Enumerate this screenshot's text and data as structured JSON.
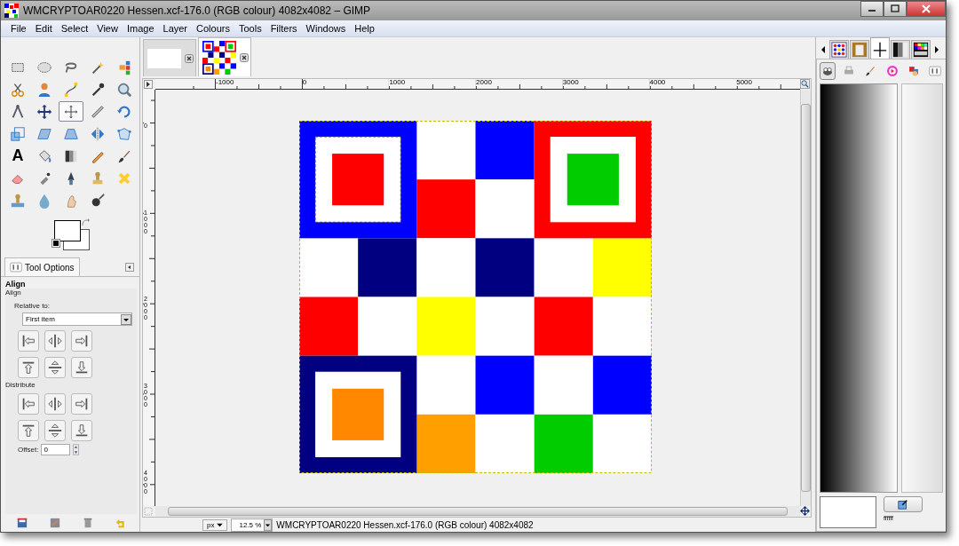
{
  "window": {
    "title": "WMCRYPTOAR0220 Hessen.xcf-176.0 (RGB colour) 4082x4082 – GIMP"
  },
  "menu": [
    "File",
    "Edit",
    "Select",
    "View",
    "Image",
    "Layer",
    "Colours",
    "Tools",
    "Filters",
    "Windows",
    "Help"
  ],
  "toolbox": {
    "tools": [
      {
        "kind": "rect-select",
        "selected": false
      },
      {
        "kind": "ellipse-select",
        "selected": false
      },
      {
        "kind": "lasso",
        "selected": false
      },
      {
        "kind": "fuzzy-select",
        "selected": false
      },
      {
        "kind": "color-select",
        "selected": false
      },
      {
        "kind": "scissors",
        "selected": false
      },
      {
        "kind": "foreground-select",
        "selected": false
      },
      {
        "kind": "paths",
        "selected": false
      },
      {
        "kind": "color-picker",
        "selected": false
      },
      {
        "kind": "zoom",
        "selected": false
      },
      {
        "kind": "measure",
        "selected": false
      },
      {
        "kind": "move",
        "selected": false
      },
      {
        "kind": "align",
        "selected": true
      },
      {
        "kind": "crop",
        "selected": false
      },
      {
        "kind": "rotate",
        "selected": false
      },
      {
        "kind": "scale",
        "selected": false
      },
      {
        "kind": "shear",
        "selected": false
      },
      {
        "kind": "perspective",
        "selected": false
      },
      {
        "kind": "flip",
        "selected": false
      },
      {
        "kind": "cage",
        "selected": false
      },
      {
        "kind": "text",
        "glyph": "A",
        "selected": false
      },
      {
        "kind": "bucket-fill",
        "selected": false
      },
      {
        "kind": "gradient",
        "selected": false
      },
      {
        "kind": "pencil",
        "selected": false
      },
      {
        "kind": "paintbrush",
        "selected": false
      },
      {
        "kind": "eraser",
        "selected": false
      },
      {
        "kind": "airbrush",
        "selected": false
      },
      {
        "kind": "ink",
        "selected": false
      },
      {
        "kind": "clone",
        "selected": false
      },
      {
        "kind": "heal",
        "selected": false
      },
      {
        "kind": "perspective-clone",
        "selected": false
      },
      {
        "kind": "blur",
        "selected": false
      },
      {
        "kind": "smudge",
        "selected": false
      },
      {
        "kind": "dodge-burn",
        "selected": false
      }
    ]
  },
  "image_tabs": [
    {
      "kind": "blank",
      "selected": false
    },
    {
      "kind": "checker",
      "selected": true
    }
  ],
  "tool_options": {
    "tab": "Tool Options",
    "title": "Align",
    "section": "Align",
    "relative_label": "Relative to:",
    "relative_value": "First item",
    "align_buttons": [
      {
        "kind": "left"
      },
      {
        "kind": "hcenter"
      },
      {
        "kind": "right"
      },
      {
        "kind": "top"
      },
      {
        "kind": "vcenter"
      },
      {
        "kind": "bottom"
      }
    ],
    "distribute_label": "Distribute",
    "distribute_buttons": [
      {
        "kind": "left"
      },
      {
        "kind": "hcenter"
      },
      {
        "kind": "right"
      },
      {
        "kind": "top"
      },
      {
        "kind": "vcenter"
      },
      {
        "kind": "bottom"
      }
    ],
    "offset_label": "Offset:",
    "offset_value": "0"
  },
  "rulers": {
    "horizontal": [
      "-1000",
      "0",
      "1000",
      "2000",
      "3000",
      "4000",
      "5000"
    ],
    "vertical": [
      "0",
      "1000",
      "2000",
      "3000",
      "4000"
    ]
  },
  "status_bar": {
    "unit": "px",
    "zoom": "12.5 %",
    "message": "WMCRYPTOAR0220 Hessen.xcf-176.0 (RGB colour) 4082x4082"
  },
  "dock": {
    "tabs": [
      {
        "kind": "patterns",
        "selected": false
      },
      {
        "kind": "clipboard",
        "selected": false
      },
      {
        "kind": "curve",
        "selected": true
      },
      {
        "kind": "gradient",
        "selected": false
      },
      {
        "kind": "palette",
        "selected": false
      }
    ],
    "subtabs": [
      {
        "kind": "creature",
        "selected": true
      },
      {
        "kind": "printer",
        "selected": false
      },
      {
        "kind": "brush",
        "selected": false
      },
      {
        "kind": "color-wheel",
        "selected": false
      },
      {
        "kind": "color-blocks",
        "selected": false
      },
      {
        "kind": "tool-options",
        "selected": false
      }
    ],
    "hex": "ffffff"
  }
}
